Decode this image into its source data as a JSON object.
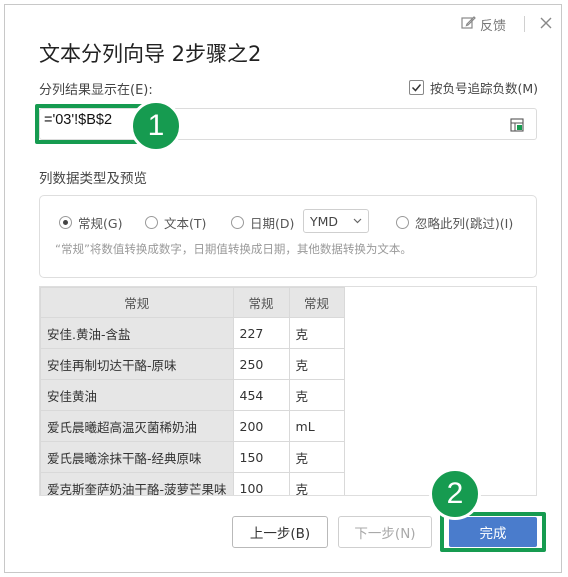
{
  "dialog": {
    "title": "文本分列向导 2步骤之2",
    "feedback_label": "反馈"
  },
  "destination": {
    "label": "分列结果显示在(E):",
    "value": "='03'!$B$2",
    "negative_checkbox": {
      "label": "按负号追踪负数(M)",
      "checked": true
    }
  },
  "column_type": {
    "section_label": "列数据类型及预览",
    "options": [
      {
        "label": "常规(G)",
        "selected": true
      },
      {
        "label": "文本(T)",
        "selected": false
      },
      {
        "label": "日期(D)",
        "selected": false
      },
      {
        "label": "忽略此列(跳过)(I)",
        "selected": false
      }
    ],
    "date_format": "YMD",
    "hint": "“常规”将数值转换成数字，日期值转换成日期，其他数据转换为文本。"
  },
  "preview": {
    "headers": [
      "常规",
      "常规",
      "常规"
    ],
    "rows": [
      [
        "安佳.黄油-含盐",
        "227",
        "克"
      ],
      [
        "安佳再制切达干酪-原味",
        "250",
        "克"
      ],
      [
        "安佳黄油",
        "454",
        "克"
      ],
      [
        "爱氏晨曦超高温灭菌稀奶油",
        "200",
        "mL"
      ],
      [
        "爱氏晨曦涂抹干酪-经典原味",
        "150",
        "克"
      ],
      [
        "爱克斯奎萨奶油干酪-菠萝芒果味",
        "100",
        "克"
      ]
    ]
  },
  "buttons": {
    "prev": "上一步(B)",
    "next": "下一步(N)",
    "finish": "完成"
  },
  "annotations": {
    "badge1": "1",
    "badge2": "2"
  },
  "colors": {
    "highlight": "#169b50",
    "primary_button": "#4a7ccc"
  },
  "icons": [
    "feedback-edit-icon",
    "close-icon",
    "range-select-icon",
    "checkmark-icon",
    "chevron-down-icon"
  ]
}
